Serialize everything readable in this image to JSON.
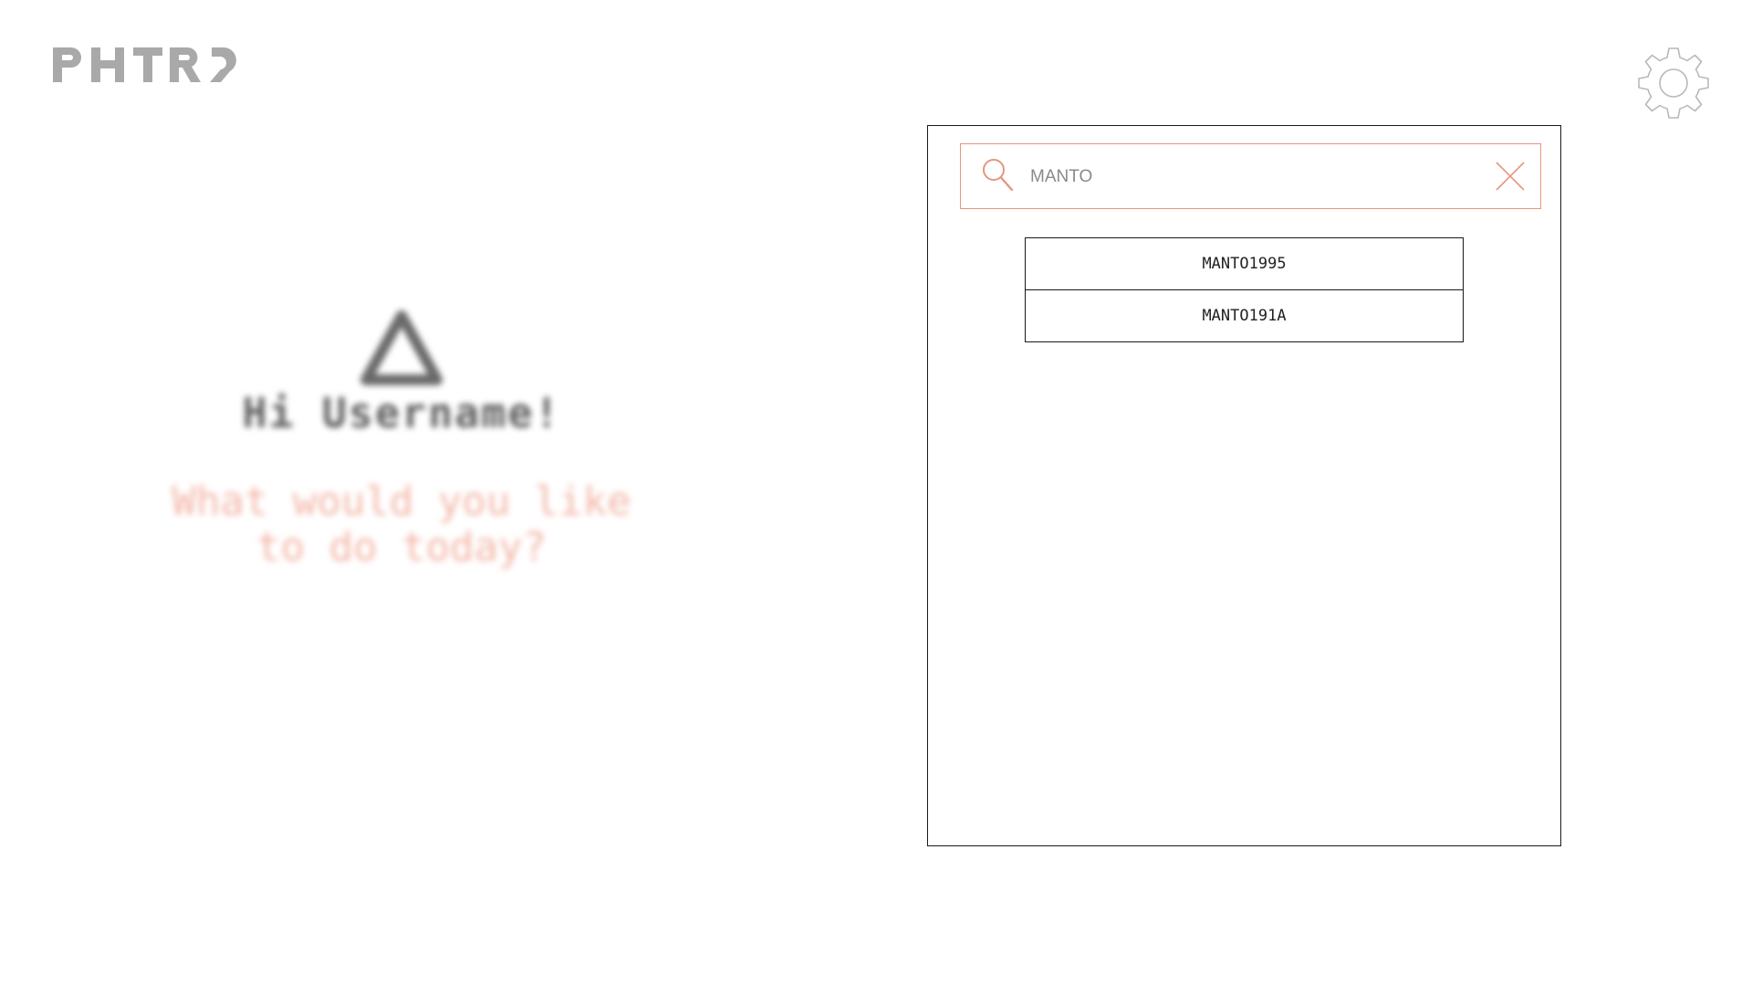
{
  "brand": {
    "logo_text": "PHTRS",
    "logo_color": "#a9a9a9"
  },
  "header": {
    "settings_icon": "gear-icon"
  },
  "greeting": {
    "icon": "triangle-warning-icon",
    "title": "Hi Username!",
    "question": "What would you like\nto do today?",
    "title_color": "#5f5f5f",
    "question_color": "#f3b6a7"
  },
  "search": {
    "value": "MANTO",
    "icon": "search-icon",
    "clear_icon": "close-icon",
    "accent_color": "#e6957f"
  },
  "results": [
    {
      "label": "MANTO1995"
    },
    {
      "label": "MANTO191A"
    }
  ]
}
